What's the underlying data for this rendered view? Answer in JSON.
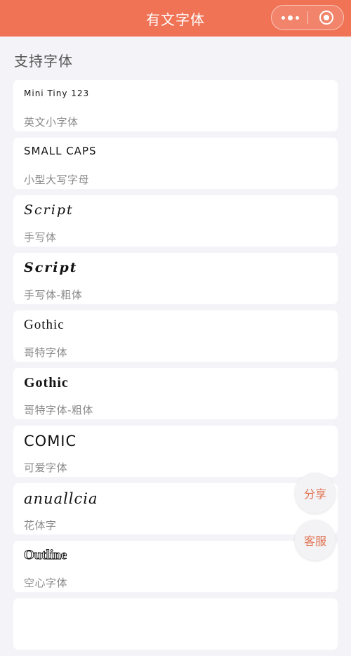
{
  "header": {
    "title": "有文字体",
    "more_icon": "more-dots-icon",
    "close_icon": "target-circle-icon",
    "bg_color": "#f07356"
  },
  "section": {
    "title": "支持字体"
  },
  "fonts": [
    {
      "sample": "Mini Tiny 123",
      "caption": "英文小字体"
    },
    {
      "sample": "SMALL CAPS",
      "caption": "小型大写字母"
    },
    {
      "sample": "Script",
      "caption": "手写体"
    },
    {
      "sample": "Script",
      "caption": "手写体-粗体"
    },
    {
      "sample": "Gothic",
      "caption": "哥特字体"
    },
    {
      "sample": "Gothic",
      "caption": "哥特字体-粗体"
    },
    {
      "sample": "COMIC",
      "caption": "可爱字体"
    },
    {
      "sample": "anuallcia",
      "caption": "花体字"
    },
    {
      "sample": "Outline",
      "caption": "空心字体"
    }
  ],
  "floating": {
    "share_label": "分享",
    "service_label": "客服",
    "accent_color": "#e07150"
  }
}
